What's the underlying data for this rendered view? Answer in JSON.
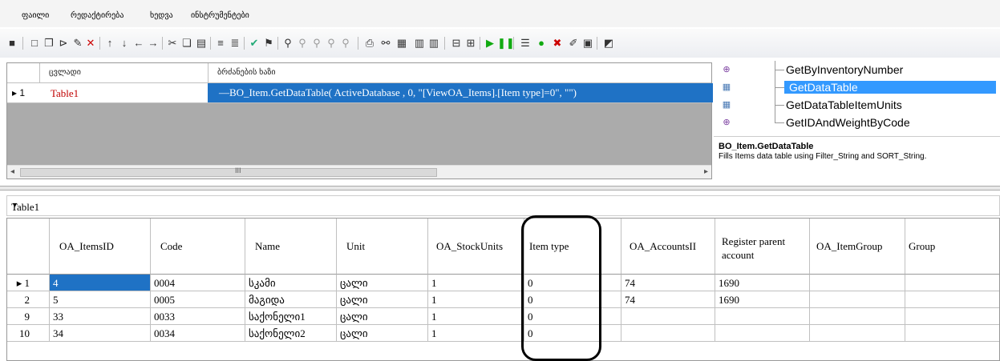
{
  "menu": [
    "ფაილი",
    "რედაქტირება",
    "ხედვა",
    "ინსტრუმენტები"
  ],
  "toolbar_icons": [
    "save-icon",
    "new-icon",
    "copy-icon",
    "open-icon",
    "edit-icon",
    "delete-icon",
    "up-icon",
    "down-icon",
    "left-icon",
    "right-icon",
    "cut-icon",
    "paste-icon",
    "list-icon",
    "indent-icon",
    "check-icon",
    "filter-icon",
    "link-icon",
    "print-icon",
    "find-icon",
    "format-icon",
    "table-icon",
    "run-icon",
    "pause-icon",
    "stop-icon",
    "settings-icon",
    "xml-icon",
    "chart-icon"
  ],
  "top_grid": {
    "col_variable": "ცვლადი",
    "col_command": "ბრძანების ხაზი",
    "row_indicator": "▸ 1",
    "variable": "Table1",
    "command": "—BO_Item.GetDataTable( ActiveDatabase , 0, \"[ViewOA_Items].[Item type]=0\", \"\")",
    "scroll_grip": "III"
  },
  "method_tree": [
    {
      "label": "GetByInventoryNumber",
      "icon": "method-icon",
      "selected": false
    },
    {
      "label": "GetDataTable",
      "icon": "table-icon",
      "selected": true
    },
    {
      "label": "GetDataTableItemUnits",
      "icon": "table-icon",
      "selected": false
    },
    {
      "label": "GetIDAndWeightByCode",
      "icon": "method-icon",
      "selected": false
    }
  ],
  "description": {
    "title": "BO_Item.GetDataTable",
    "text": "Fills Items data table using Filter_String and SORT_String."
  },
  "table_label": "Table1",
  "columns": [
    "OA_ItemsID",
    "Code",
    "Name",
    "Unit",
    "OA_StockUnits",
    "Item type",
    "OA_AccountsII",
    "Register parent account",
    "OA_ItemGroup",
    "Group"
  ],
  "rows": [
    {
      "num": "▸ 1",
      "cells": [
        "4",
        "0004",
        "სკამი",
        "ცალი",
        "1",
        "0",
        "74",
        "1690",
        "",
        ""
      ]
    },
    {
      "num": "2",
      "cells": [
        "5",
        "0005",
        "მაგიდა",
        "ცალი",
        "1",
        "0",
        "74",
        "1690",
        "",
        ""
      ]
    },
    {
      "num": "9",
      "cells": [
        "33",
        "0033",
        "საქონელი1",
        "ცალი",
        "1",
        "0",
        "",
        "",
        "",
        ""
      ]
    },
    {
      "num": "10",
      "cells": [
        "34",
        "0034",
        "საქონელი2",
        "ცალი",
        "1",
        "0",
        "",
        "",
        "",
        ""
      ]
    }
  ],
  "colors": {
    "selection": "#1f72c5",
    "tree_selection": "#3399ff",
    "variable_text": "#c00000"
  }
}
